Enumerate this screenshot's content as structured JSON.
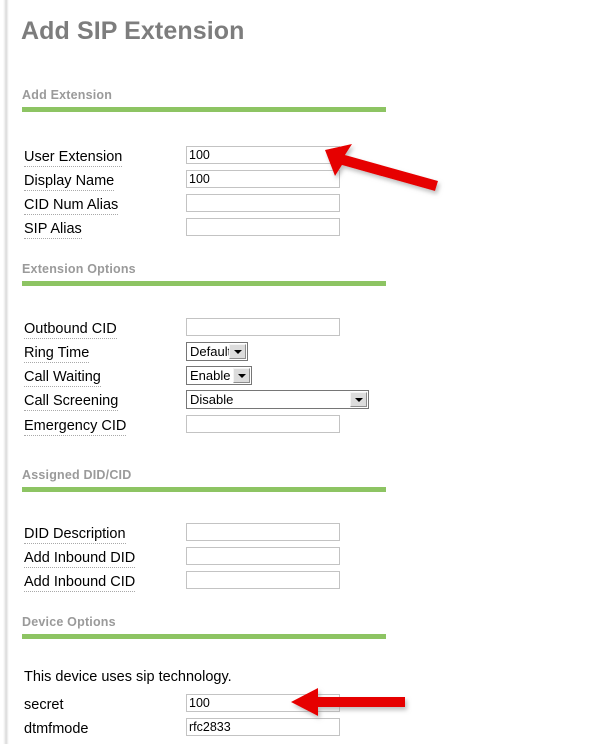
{
  "page": {
    "title": "Add SIP Extension"
  },
  "sections": [
    {
      "name": "add-extension",
      "title": "Add Extension",
      "fields": [
        {
          "label": "User Extension",
          "type": "text",
          "value": "100",
          "placeholder": ""
        },
        {
          "label": "Display Name",
          "type": "text",
          "value": "100",
          "placeholder": ""
        },
        {
          "label": "CID Num Alias",
          "type": "text",
          "value": "",
          "placeholder": ""
        },
        {
          "label": "SIP Alias",
          "type": "text",
          "value": "",
          "placeholder": ""
        }
      ]
    },
    {
      "name": "extension-options",
      "title": "Extension Options",
      "fields": [
        {
          "label": "Outbound CID",
          "type": "text",
          "value": "",
          "placeholder": ""
        },
        {
          "label": "Ring Time",
          "type": "select",
          "value": "Default",
          "options": [
            "Default"
          ]
        },
        {
          "label": "Call Waiting",
          "type": "select",
          "value": "Enable",
          "options": [
            "Enable"
          ]
        },
        {
          "label": "Call Screening",
          "type": "select",
          "value": "Disable",
          "options": [
            "Disable"
          ]
        },
        {
          "label": "Emergency CID",
          "type": "text",
          "value": "",
          "placeholder": ""
        }
      ]
    },
    {
      "name": "assigned-did-cid",
      "title": "Assigned DID/CID",
      "fields": [
        {
          "label": "DID Description",
          "type": "text",
          "value": "",
          "placeholder": ""
        },
        {
          "label": "Add Inbound DID",
          "type": "text",
          "value": "",
          "placeholder": ""
        },
        {
          "label": "Add Inbound CID",
          "type": "text",
          "value": "",
          "placeholder": ""
        }
      ]
    },
    {
      "name": "device-options",
      "title": "Device Options",
      "note": "This device uses sip technology.",
      "fields": [
        {
          "label": "secret",
          "type": "text",
          "value": "100",
          "placeholder": "",
          "dotted": false
        },
        {
          "label": "dtmfmode",
          "type": "text",
          "value": "rfc2833",
          "placeholder": "",
          "dotted": false
        }
      ]
    }
  ],
  "annotations": {
    "color": "#e60000",
    "arrows": [
      {
        "name": "arrow-user-extension",
        "target": "User Extension field"
      },
      {
        "name": "arrow-secret",
        "target": "secret field"
      }
    ]
  },
  "colors": {
    "accent_green": "#8dc463",
    "title_gray": "#7d7d7d",
    "section_gray": "#9a9a9a",
    "input_border": "#c3c3c3",
    "arrow_red": "#e60000"
  }
}
